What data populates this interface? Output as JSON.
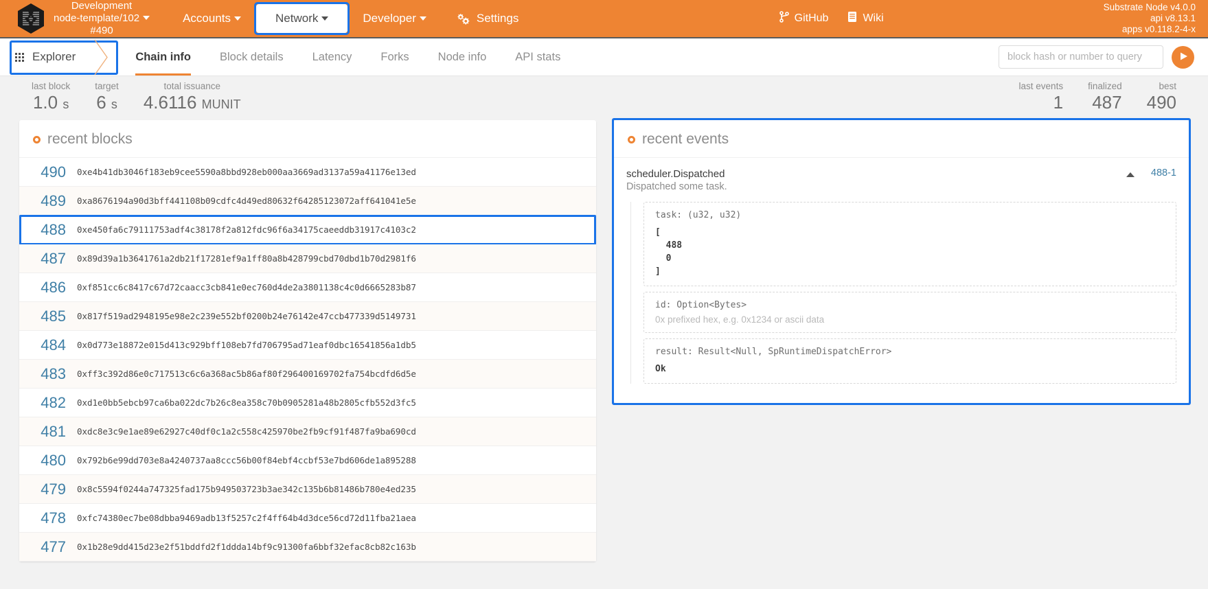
{
  "topbar": {
    "chain_name": "Development",
    "chain_node": "node-template/102",
    "chain_block": "#490",
    "nav": [
      {
        "label": "Accounts",
        "has_caret": true,
        "active": false,
        "icon": null
      },
      {
        "label": "Network",
        "has_caret": true,
        "active": true,
        "icon": null
      },
      {
        "label": "Developer",
        "has_caret": true,
        "active": false,
        "icon": null
      },
      {
        "label": "Settings",
        "has_caret": false,
        "active": false,
        "icon": "gear-icon"
      }
    ],
    "external_links": [
      {
        "label": "GitHub",
        "icon": "git-branch-icon"
      },
      {
        "label": "Wiki",
        "icon": "book-icon"
      }
    ],
    "version_node": "Substrate Node v4.0.0",
    "version_api": "api v8.13.1",
    "version_apps": "apps v0.118.2-4-x"
  },
  "tabbar": {
    "section_label": "Explorer",
    "section_icon": "grid-icon",
    "tabs": [
      {
        "label": "Chain info",
        "active": true
      },
      {
        "label": "Block details",
        "active": false
      },
      {
        "label": "Latency",
        "active": false
      },
      {
        "label": "Forks",
        "active": false
      },
      {
        "label": "Node info",
        "active": false
      },
      {
        "label": "API stats",
        "active": false
      }
    ],
    "query_placeholder": "block hash or number to query",
    "query_value": "",
    "submit_icon": "play-icon"
  },
  "summary": {
    "left": [
      {
        "label": "last block",
        "value": "1.0",
        "unit": "s"
      },
      {
        "label": "target",
        "value": "6",
        "unit": "s"
      },
      {
        "label": "total issuance",
        "value": "4.6116",
        "unit": "MUNIT"
      }
    ],
    "right": [
      {
        "label": "last events",
        "value": "1",
        "unit": ""
      },
      {
        "label": "finalized",
        "value": "487",
        "unit": ""
      },
      {
        "label": "best",
        "value": "490",
        "unit": ""
      }
    ]
  },
  "blocks_panel": {
    "title": "recent blocks",
    "rows": [
      {
        "number": "490",
        "hash": "0xe4b41db3046f183eb9cee5590a8bbd928eb000aa3669ad3137a59a41176e13ed",
        "highlighted": false
      },
      {
        "number": "489",
        "hash": "0xa8676194a90d3bff441108b09cdfc4d49ed80632f64285123072aff641041e5e",
        "highlighted": false
      },
      {
        "number": "488",
        "hash": "0xe450fa6c79111753adf4c38178f2a812fdc96f6a34175caeeddb31917c4103c2",
        "highlighted": true
      },
      {
        "number": "487",
        "hash": "0x89d39a1b3641761a2db21f17281ef9a1ff80a8b428799cbd70dbd1b70d2981f6",
        "highlighted": false
      },
      {
        "number": "486",
        "hash": "0xf851cc6c8417c67d72caacc3cb841e0ec760d4de2a3801138c4c0d6665283b87",
        "highlighted": false
      },
      {
        "number": "485",
        "hash": "0x817f519ad2948195e98e2c239e552bf0200b24e76142e47ccb477339d5149731",
        "highlighted": false
      },
      {
        "number": "484",
        "hash": "0x0d773e18872e015d413c929bff108eb7fd706795ad71eaf0dbc16541856a1db5",
        "highlighted": false
      },
      {
        "number": "483",
        "hash": "0xff3c392d86e0c717513c6c6a368ac5b86af80f296400169702fa754bcdfd6d5e",
        "highlighted": false
      },
      {
        "number": "482",
        "hash": "0xd1e0bb5ebcb97ca6ba022dc7b26c8ea358c70b0905281a48b2805cfb552d3fc5",
        "highlighted": false
      },
      {
        "number": "481",
        "hash": "0xdc8e3c9e1ae89e62927c40df0c1a2c558c425970be2fb9cf91f487fa9ba690cd",
        "highlighted": false
      },
      {
        "number": "480",
        "hash": "0x792b6e99dd703e8a4240737aa8ccc56b00f84ebf4ccbf53e7bd606de1a895288",
        "highlighted": false
      },
      {
        "number": "479",
        "hash": "0x8c5594f0244a747325fad175b949503723b3ae342c135b6b81486b780e4ed235",
        "highlighted": false
      },
      {
        "number": "478",
        "hash": "0xfc74380ec7be08dbba9469adb13f5257c2f4ff64b4d3dce56cd72d11fba21aea",
        "highlighted": false
      },
      {
        "number": "477",
        "hash": "0x1b28e9dd415d23e2f51bddfd2f1ddda14bf9c91300fa6bbf32efac8cb82c163b",
        "highlighted": false
      }
    ]
  },
  "events_panel": {
    "title": "recent events",
    "highlighted": true,
    "events": [
      {
        "name": "scheduler.Dispatched",
        "description": "Dispatched some task.",
        "index": "488-1",
        "params": [
          {
            "label": "task: (u32, u32)",
            "value": "[\n  488\n  0\n]",
            "placeholder": ""
          },
          {
            "label": "id: Option<Bytes>",
            "value": "",
            "placeholder": "0x prefixed hex, e.g. 0x1234 or ascii data"
          },
          {
            "label": "result: Result<Null, SpRuntimeDispatchError>",
            "value": "Ok",
            "placeholder": ""
          }
        ]
      }
    ]
  },
  "colors": {
    "brand_orange": "#ee8433",
    "highlight_blue": "#1a73e8",
    "link_blue": "#3f7fa6",
    "page_bg": "#f2f2f2"
  }
}
